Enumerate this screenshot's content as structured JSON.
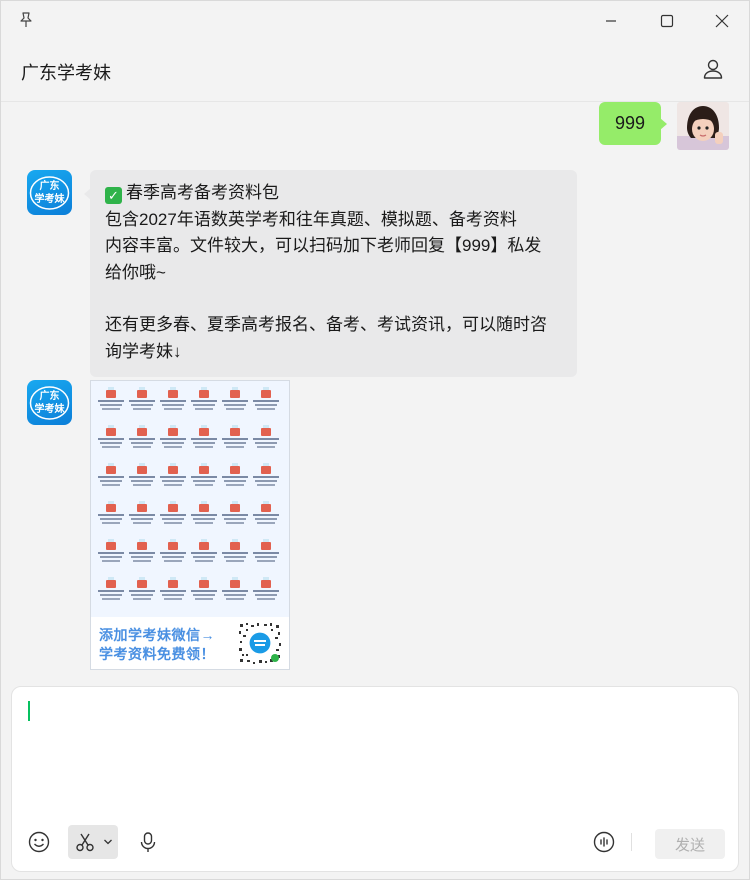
{
  "window": {
    "title": "广东学考妹"
  },
  "colors": {
    "accent_green": "#07c160",
    "my_bubble": "#95ec69",
    "their_bubble": "#e9e9ea",
    "brand_blue": "#0b7ed8"
  },
  "messages": {
    "outgoing": {
      "text": "999"
    },
    "incoming_text": {
      "sender_logo_line1": "广东",
      "sender_logo_line2": "学考妹",
      "lines": [
        "春季高考备考资料包",
        "包含2027年语数英学考和往年真题、模拟题、备考资料",
        "内容丰富。文件较大，可以扫码加下老师回复【999】私发",
        "给你哦~",
        "",
        "还有更多春、夏季高考报名、备考、考试资讯，可以随时咨",
        "询学考妹↓"
      ]
    },
    "incoming_image": {
      "banner_line1": "添加学考妹微信→",
      "banner_line2": "学考资料免费领！"
    }
  },
  "composer": {
    "send_label": "发送"
  },
  "icons": {
    "pin": "pin-icon",
    "minimize": "minimize-icon",
    "maximize": "maximize-icon",
    "close": "close-icon",
    "profile": "person-icon",
    "emoji": "emoji-icon",
    "screenshot": "scissors-icon",
    "dropdown": "chevron-down-icon",
    "voice": "microphone-icon",
    "voice_call": "voice-input-icon"
  }
}
